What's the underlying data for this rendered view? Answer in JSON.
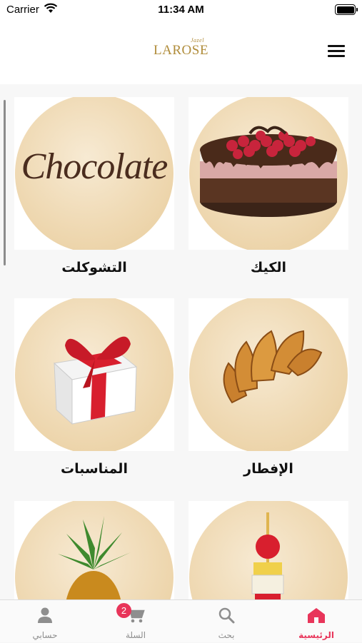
{
  "status_bar": {
    "carrier": "Carrier",
    "time": "11:34 AM"
  },
  "header": {
    "logo_text": "LAROSE",
    "logo_small": "Jazel"
  },
  "categories": [
    {
      "label": "الكيك",
      "icon": "cake-image"
    },
    {
      "label": "التشوكلت",
      "icon": "chocolate-image",
      "image_text": "Chocolate"
    },
    {
      "label": "الإفطار",
      "icon": "croissant-image"
    },
    {
      "label": "المناسبات",
      "icon": "gift-box-image"
    },
    {
      "label": "",
      "icon": "fruit-skewer-image"
    },
    {
      "label": "",
      "icon": "pineapple-image"
    }
  ],
  "tabbar": {
    "tabs": [
      {
        "label": "الرئيسية",
        "icon": "home-icon",
        "active": true
      },
      {
        "label": "بحث",
        "icon": "search-icon"
      },
      {
        "label": "السلة",
        "icon": "cart-icon",
        "badge": "2"
      },
      {
        "label": "حسابي",
        "icon": "person-icon"
      }
    ]
  },
  "colors": {
    "accent": "#e8355a",
    "logo_gold": "#b08c3a"
  }
}
